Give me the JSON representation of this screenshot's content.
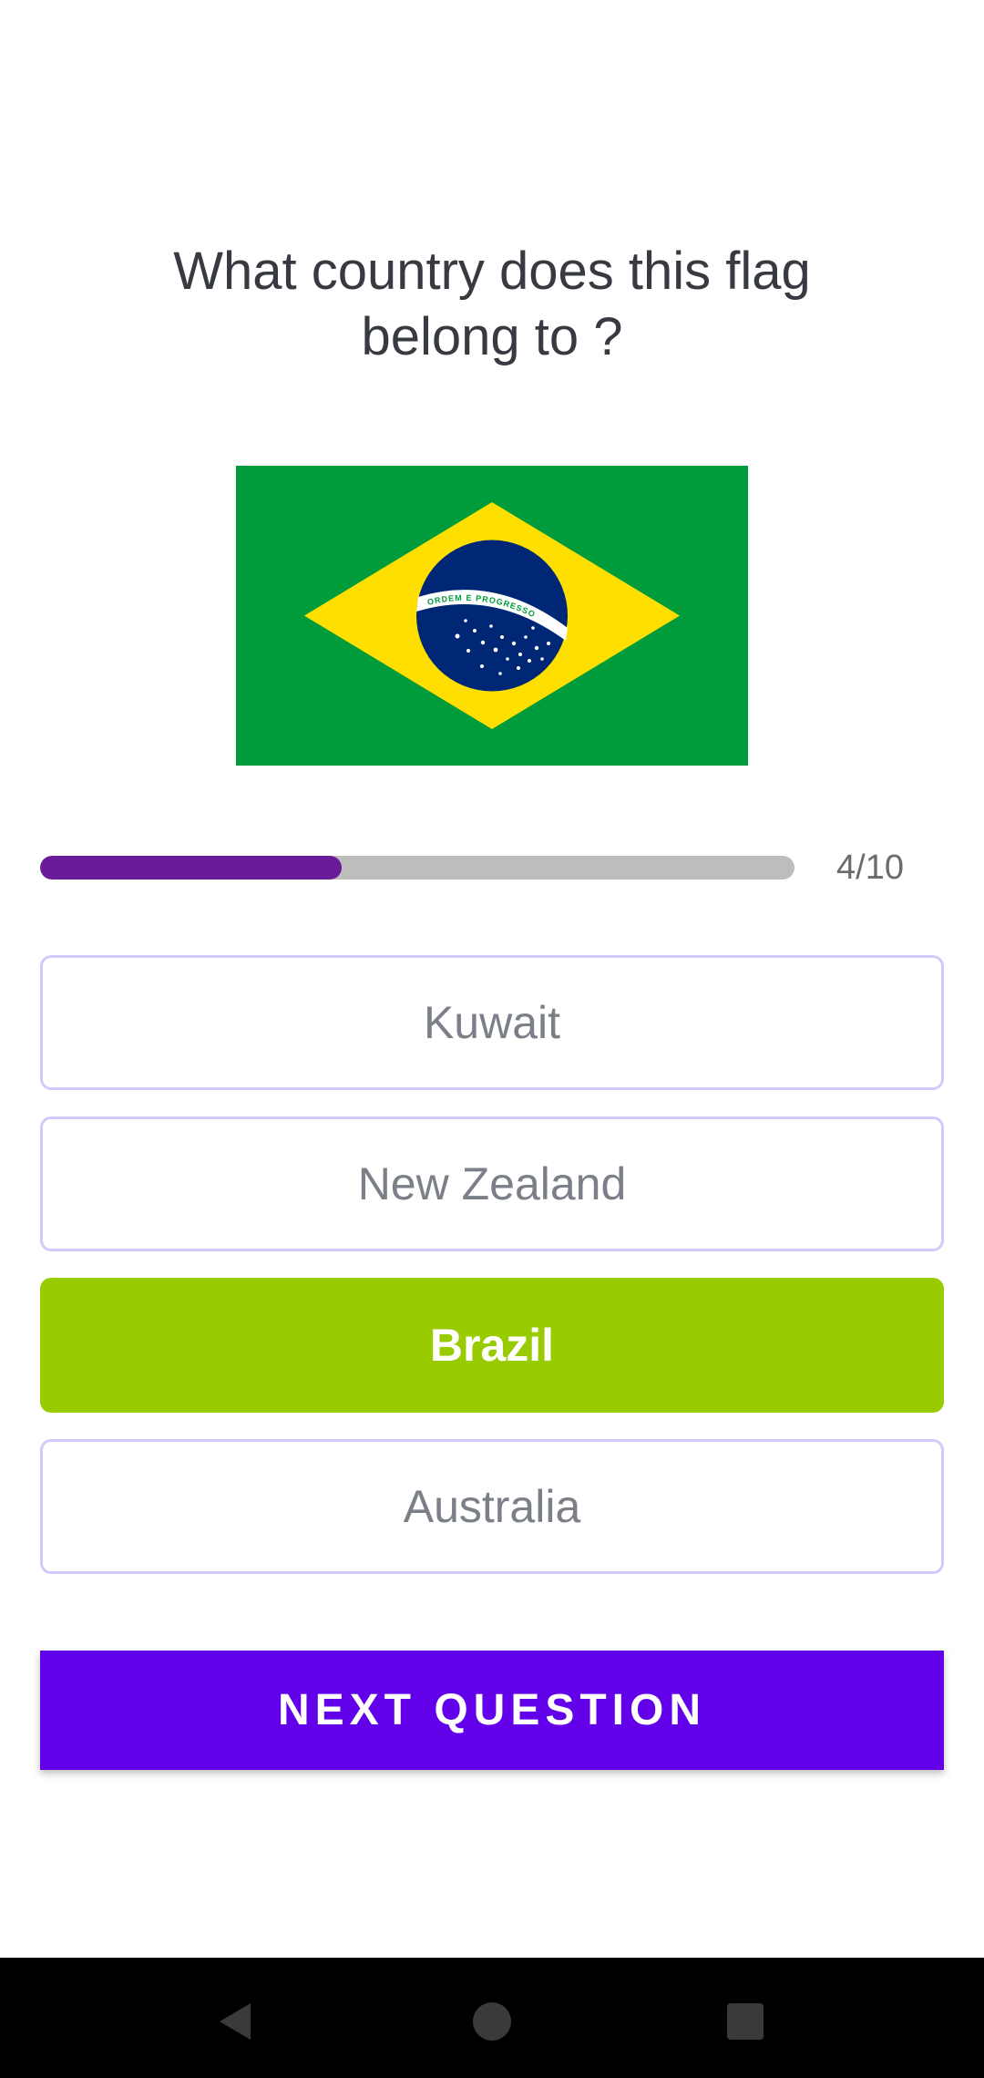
{
  "question": {
    "line1": "What country does this flag",
    "line2": "belong to ?"
  },
  "flag": {
    "icon": "brazil-flag",
    "motto": "ORDEM E PROGRESSO",
    "colors": {
      "green": "#009b3a",
      "yellow": "#fedf00",
      "blue": "#002776",
      "white": "#ffffff"
    }
  },
  "progress": {
    "current": 4,
    "total": 10,
    "fraction": 0.4,
    "label": "4/10",
    "fill_color": "#6a1b9a",
    "track_color": "#bdbdbd"
  },
  "options": [
    {
      "label": "Kuwait",
      "state": "default"
    },
    {
      "label": "New Zealand",
      "state": "default"
    },
    {
      "label": "Brazil",
      "state": "correct"
    },
    {
      "label": "Australia",
      "state": "default"
    }
  ],
  "colors": {
    "correct": "#99cc00",
    "option_border": "#d4c8fb",
    "accent": "#6200ea"
  },
  "next_button": {
    "label": "NEXT QUESTION"
  },
  "navbar": {
    "items": [
      {
        "icon": "back-icon"
      },
      {
        "icon": "home-icon"
      },
      {
        "icon": "recents-icon"
      }
    ]
  }
}
